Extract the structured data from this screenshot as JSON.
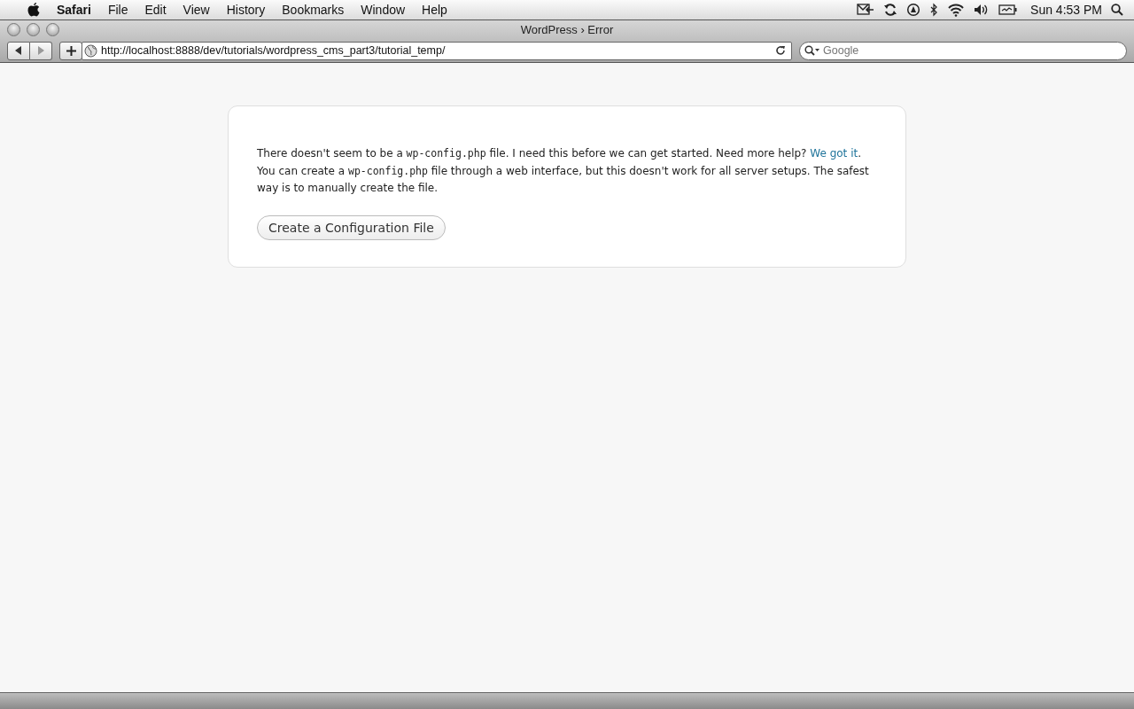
{
  "menu_bar": {
    "app": "Safari",
    "items": [
      "File",
      "Edit",
      "View",
      "History",
      "Bookmarks",
      "Window",
      "Help"
    ],
    "clock": "Sun 4:53 PM"
  },
  "window": {
    "title": "WordPress › Error"
  },
  "toolbar": {
    "url": "http://localhost:8888/dev/tutorials/wordpress_cms_part3/tutorial_temp/",
    "search": {
      "placeholder": "Google"
    }
  },
  "page": {
    "paragraph": [
      {
        "kind": "text",
        "text": "There doesn't seem to be a "
      },
      {
        "kind": "code",
        "text": "wp-config.php"
      },
      {
        "kind": "text",
        "text": " file. I need this before we can get started. Need more help? "
      },
      {
        "kind": "link",
        "text": "We got it"
      },
      {
        "kind": "text",
        "text": ". You can create a "
      },
      {
        "kind": "code",
        "text": "wp-config.php"
      },
      {
        "kind": "text",
        "text": " file through a web interface, but this doesn't work for all server setups. The safest way is to manually create the file."
      }
    ],
    "button": "Create a Configuration File"
  }
}
